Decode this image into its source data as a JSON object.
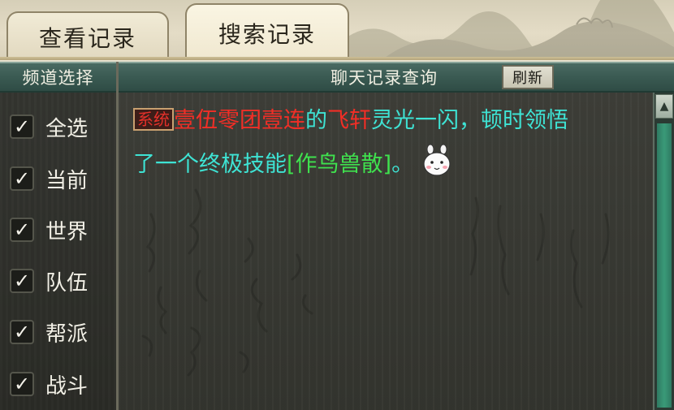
{
  "tabs": [
    {
      "label": "查看记录",
      "active": false
    },
    {
      "label": "搜索记录",
      "active": true
    }
  ],
  "sidebar": {
    "title": "频道选择",
    "items": [
      {
        "label": "全选",
        "checked": true
      },
      {
        "label": "当前",
        "checked": true
      },
      {
        "label": "世界",
        "checked": true
      },
      {
        "label": "队伍",
        "checked": true
      },
      {
        "label": "帮派",
        "checked": true
      },
      {
        "label": "战斗",
        "checked": true
      }
    ],
    "check_glyph": "✓"
  },
  "main": {
    "title": "聊天记录查询",
    "refresh_label": "刷新",
    "message": {
      "badge": "系统",
      "player": "壹伍零团壹连",
      "of": "的",
      "pet": "飞轩",
      "text1": "灵光一闪，顿时领悟",
      "text2": "了一个终极技能",
      "skill": "[作鸟兽散]",
      "end": "。"
    }
  },
  "colors": {
    "badge": "#e4302a",
    "player": "#f22e26",
    "text": "#3ee3d4",
    "skill": "#3fe14e",
    "header": "#3a5a52"
  },
  "icons": {
    "scroll_up": "triangle-up-icon",
    "mascot": "bunny-emote-icon"
  }
}
